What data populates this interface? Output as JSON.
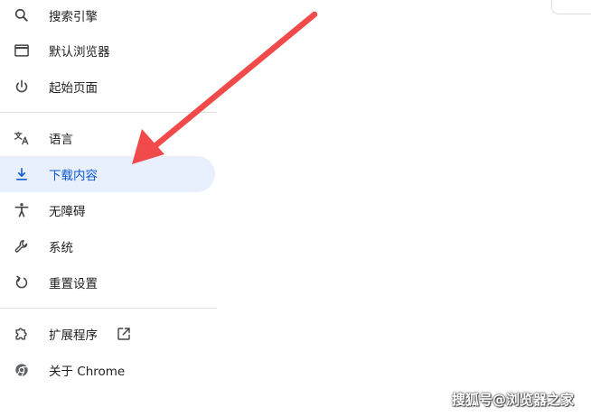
{
  "sidebar": {
    "items": [
      {
        "label": "搜索引擎",
        "icon": "search-icon"
      },
      {
        "label": "默认浏览器",
        "icon": "browser-window-icon"
      },
      {
        "label": "起始页面",
        "icon": "power-icon"
      },
      {
        "label": "语言",
        "icon": "translate-icon"
      },
      {
        "label": "下载内容",
        "icon": "download-icon",
        "active": true
      },
      {
        "label": "无障碍",
        "icon": "accessibility-icon"
      },
      {
        "label": "系统",
        "icon": "wrench-icon"
      },
      {
        "label": "重置设置",
        "icon": "reset-icon"
      },
      {
        "label": "扩展程序",
        "icon": "extension-puzzle-icon"
      },
      {
        "label": "关于 Chrome",
        "icon": "chrome-logo-icon"
      }
    ]
  },
  "colors": {
    "active_bg": "#e8f0fe",
    "active_text": "#0b57d0",
    "arrow": "#f04a4a"
  },
  "watermark": "搜狐号@浏览器之家"
}
